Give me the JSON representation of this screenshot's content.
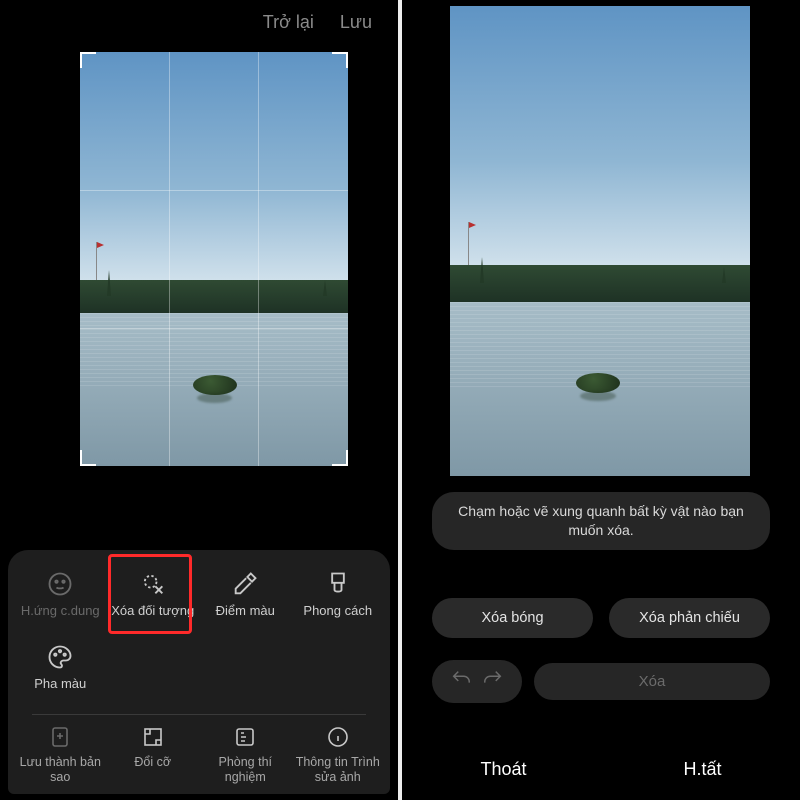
{
  "colors": {
    "highlight": "#ff2a2a",
    "panel_bg": "#1e1e1e"
  },
  "left": {
    "header": {
      "back": "Trở lại",
      "save": "Lưu"
    },
    "tools": {
      "portrait": {
        "label": "H.ứng c.dung",
        "icon": "face-icon"
      },
      "erase_obj": {
        "label": "Xóa đối tượng",
        "icon": "erase-icon",
        "highlighted": true
      },
      "spot_color": {
        "label": "Điểm màu",
        "icon": "eyedropper-icon"
      },
      "style": {
        "label": "Phong cách",
        "icon": "brush-icon"
      },
      "color_mix": {
        "label": "Pha màu",
        "icon": "palette-icon"
      }
    },
    "bottom": {
      "save_copy": {
        "label": "Lưu thành bản sao",
        "icon": "save-copy-icon"
      },
      "resize": {
        "label": "Đổi cỡ",
        "icon": "resize-icon"
      },
      "lab": {
        "label": "Phòng thí nghiệm",
        "icon": "lab-icon"
      },
      "info": {
        "label": "Thông tin Trình sửa ảnh",
        "icon": "info-icon"
      }
    }
  },
  "right": {
    "hint": "Chạm hoặc vẽ xung quanh bất kỳ vật nào bạn muốn xóa.",
    "options": {
      "erase_shadow": "Xóa bóng",
      "erase_reflection": "Xóa phản chiếu"
    },
    "history": {
      "undo": "undo-icon",
      "redo": "redo-icon",
      "delete": "Xóa"
    },
    "footer": {
      "exit": "Thoát",
      "done": "H.tất"
    }
  }
}
